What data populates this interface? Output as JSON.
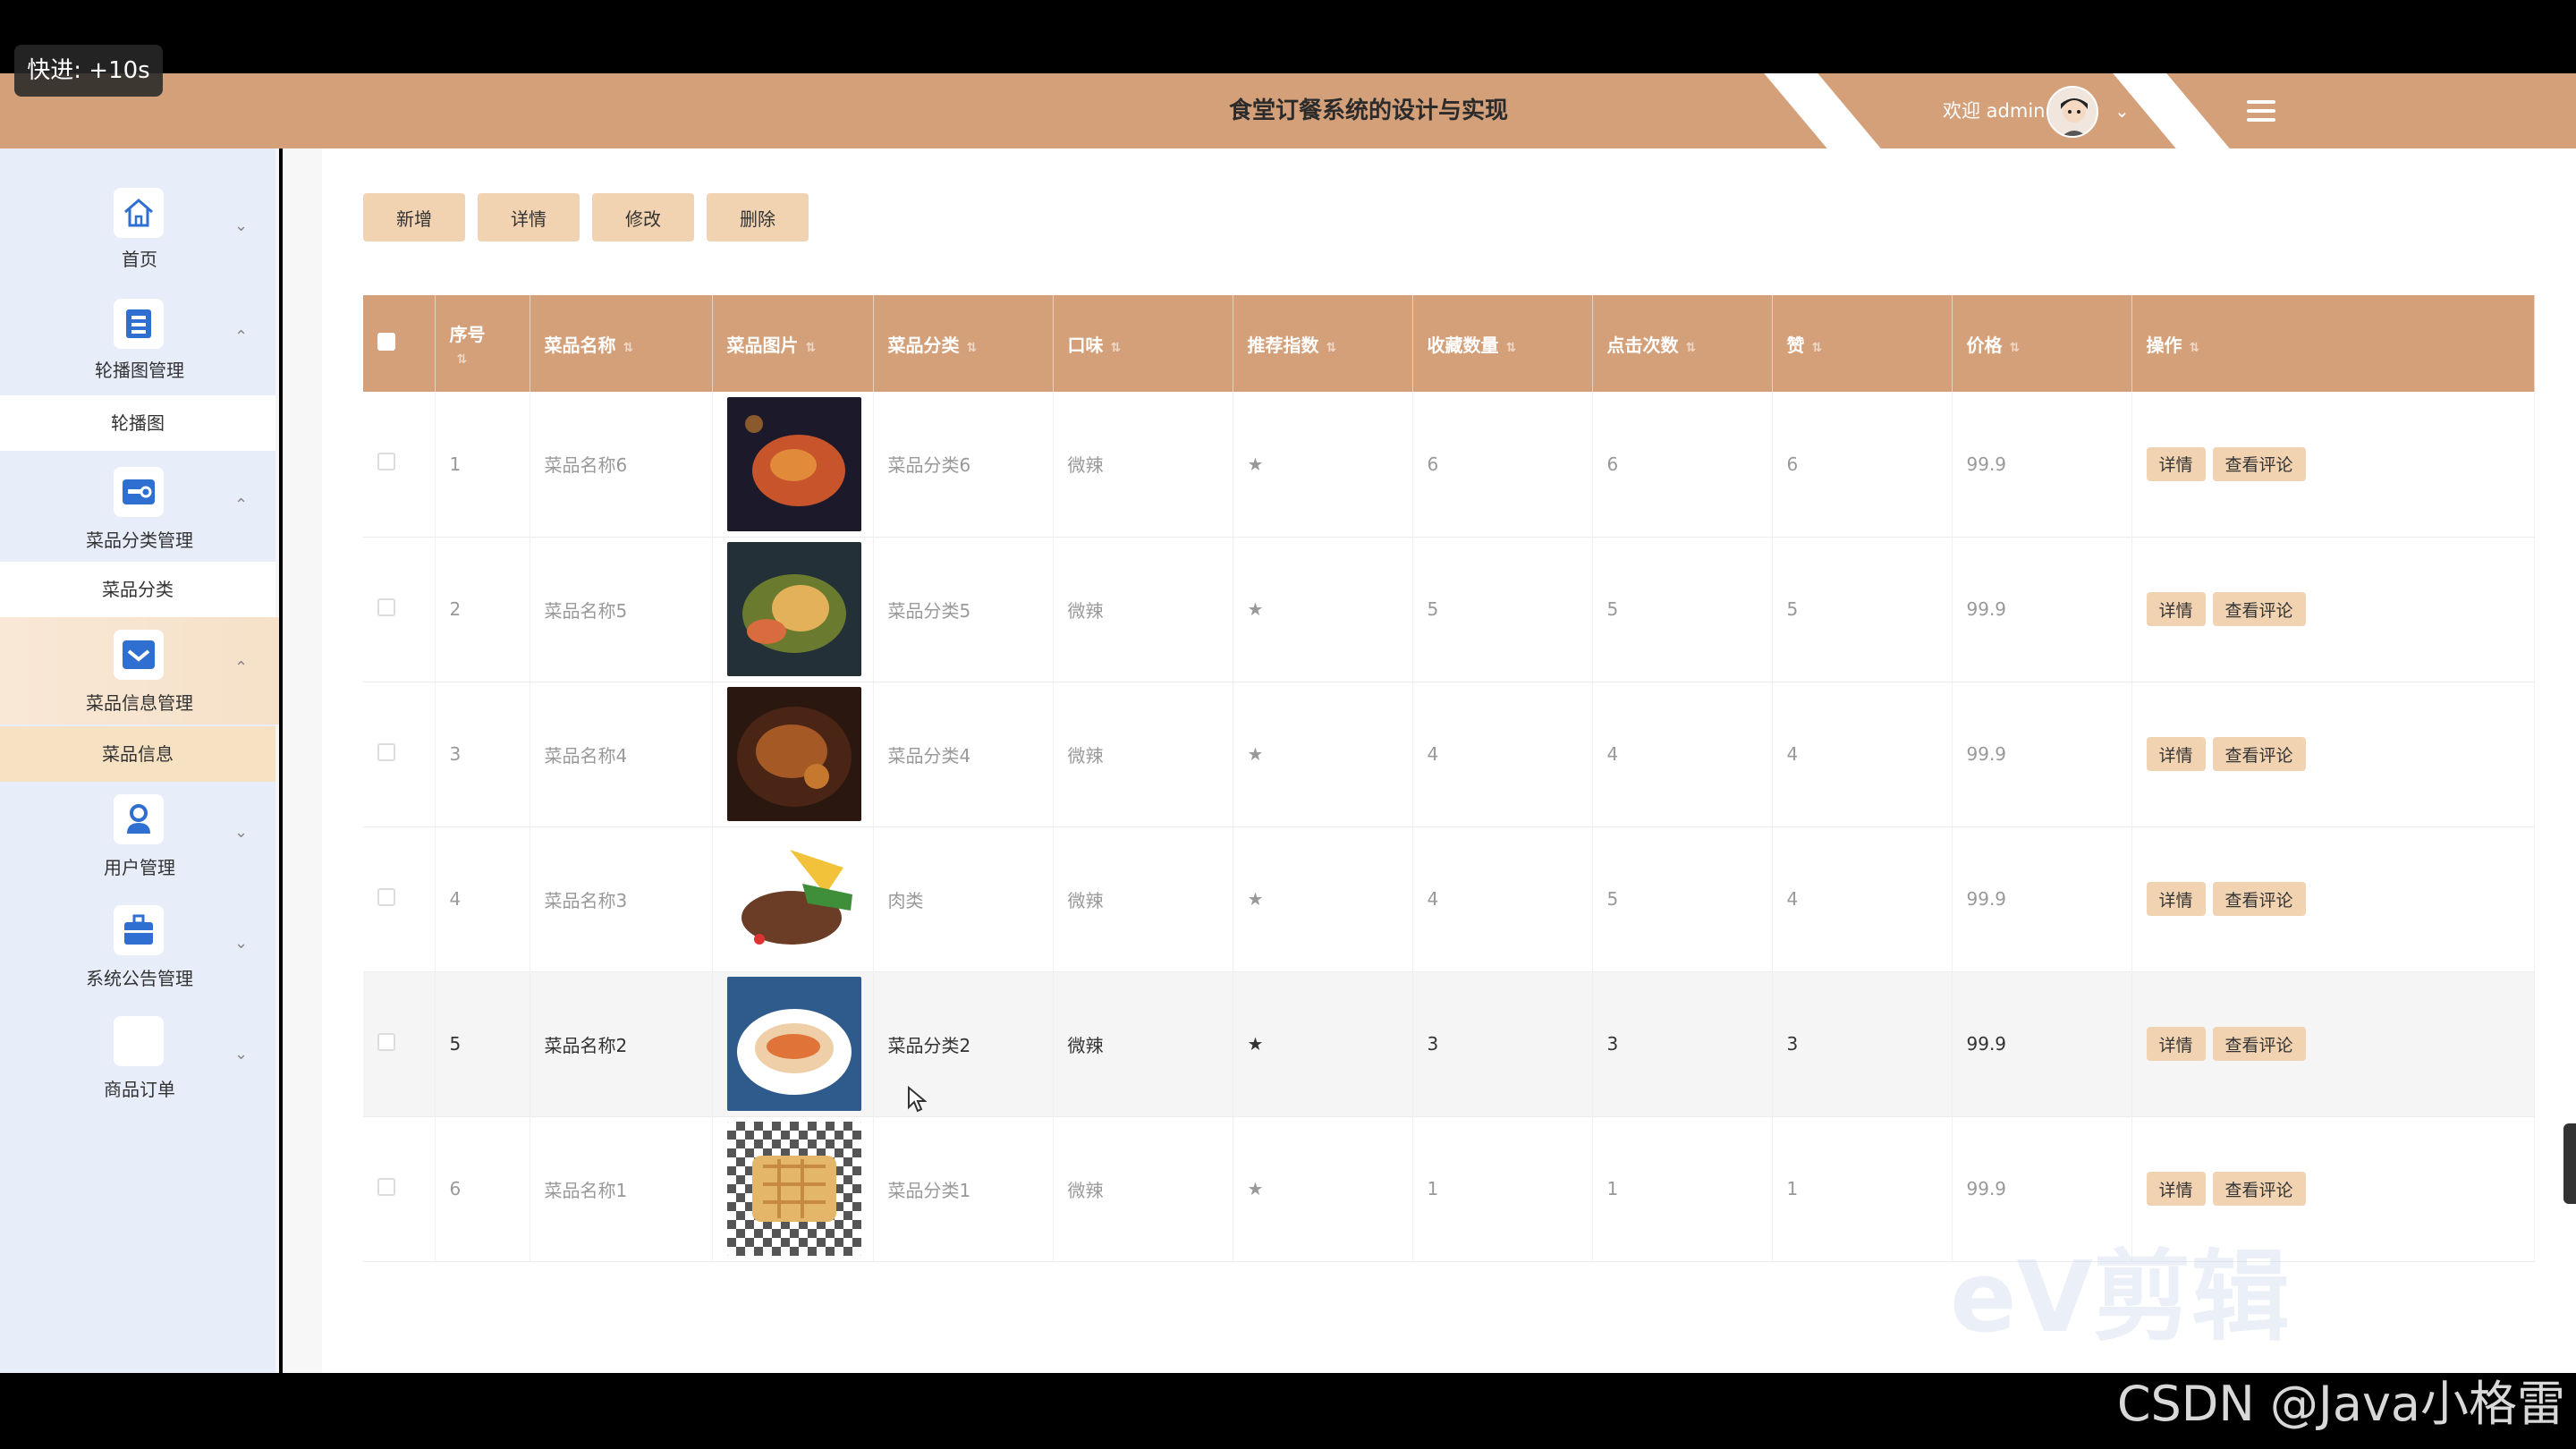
{
  "overlay": {
    "speed_label": "快进: +10s",
    "credit": "CSDN @Java小格雷",
    "watermark": "eV剪辑"
  },
  "header": {
    "title": "食堂订餐系统的设计与实现",
    "welcome": "欢迎 admin",
    "avatar_icon": "avatar-icon",
    "dropdown_icon": "chevron-down-icon",
    "menu_icon": "hamburger-icon",
    "bg_color": "#d3a07a"
  },
  "sidebar": {
    "items": [
      {
        "label": "首页",
        "icon": "home-icon"
      },
      {
        "label": "轮播图管理",
        "icon": "server-icon",
        "sub": "轮播图"
      },
      {
        "label": "菜品分类管理",
        "icon": "toggle-icon",
        "sub": "菜品分类"
      },
      {
        "label": "菜品信息管理",
        "icon": "mail-icon",
        "sub": "菜品信息"
      },
      {
        "label": "用户管理",
        "icon": "user-icon"
      },
      {
        "label": "系统公告管理",
        "icon": "briefcase-icon"
      },
      {
        "label": "商品订单",
        "icon": "blank-icon"
      }
    ]
  },
  "toolbar": {
    "add": "新增",
    "detail": "详情",
    "edit": "修改",
    "delete": "删除"
  },
  "table": {
    "headers": [
      "序号",
      "菜品名称",
      "菜品图片",
      "菜品分类",
      "口味",
      "推荐指数",
      "收藏数量",
      "点击次数",
      "赞",
      "价格",
      "操作"
    ],
    "rows": [
      {
        "no": "1",
        "name": "菜品名称6",
        "category": "菜品分类6",
        "taste": "微辣",
        "rating": "★",
        "fav": "6",
        "clicks": "6",
        "likes": "6",
        "price": "99.9"
      },
      {
        "no": "2",
        "name": "菜品名称5",
        "category": "菜品分类5",
        "taste": "微辣",
        "rating": "★",
        "fav": "5",
        "clicks": "5",
        "likes": "5",
        "price": "99.9"
      },
      {
        "no": "3",
        "name": "菜品名称4",
        "category": "菜品分类4",
        "taste": "微辣",
        "rating": "★",
        "fav": "4",
        "clicks": "4",
        "likes": "4",
        "price": "99.9"
      },
      {
        "no": "4",
        "name": "菜品名称3",
        "category": "肉类",
        "taste": "微辣",
        "rating": "★",
        "fav": "4",
        "clicks": "5",
        "likes": "4",
        "price": "99.9"
      },
      {
        "no": "5",
        "name": "菜品名称2",
        "category": "菜品分类2",
        "taste": "微辣",
        "rating": "★",
        "fav": "3",
        "clicks": "3",
        "likes": "3",
        "price": "99.9"
      },
      {
        "no": "6",
        "name": "菜品名称1",
        "category": "菜品分类1",
        "taste": "微辣",
        "rating": "★",
        "fav": "1",
        "clicks": "1",
        "likes": "1",
        "price": "99.9"
      }
    ],
    "op_detail": "详情",
    "op_comments": "查看评论"
  }
}
